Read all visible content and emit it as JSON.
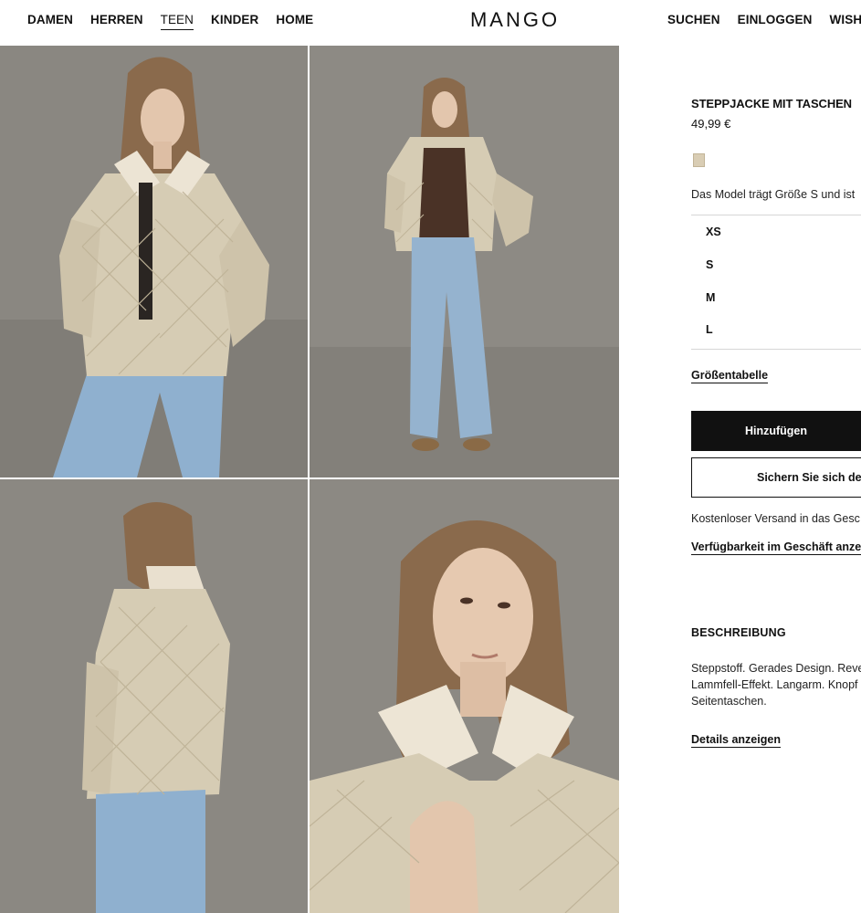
{
  "header": {
    "nav_left": [
      "DAMEN",
      "HERREN",
      "TEEN",
      "KINDER",
      "HOME"
    ],
    "active_nav": "TEEN",
    "logo": "MANGO",
    "nav_right": [
      "SUCHEN",
      "EINLOGGEN",
      "WISHL"
    ]
  },
  "gallery": {
    "photos": [
      {
        "name": "product-photo-front-closeup",
        "description_icon": "model-front-photo"
      },
      {
        "name": "product-photo-full-body",
        "description_icon": "model-fullbody-photo"
      },
      {
        "name": "product-photo-back-view",
        "description_icon": "model-back-photo"
      },
      {
        "name": "product-photo-portrait",
        "description_icon": "model-portrait-photo"
      }
    ]
  },
  "product": {
    "title": "STEPPJACKE MIT TASCHEN",
    "price": "49,99 €",
    "swatch_color": "#d9cdb4",
    "model_info": "Das Model trägt Größe S und ist",
    "sizes": [
      "XS",
      "S",
      "M",
      "L"
    ],
    "size_chart_label": "Größentabelle",
    "add_label": "Hinzufügen",
    "save_label": "Sichern Sie sich der",
    "shipping_text": "Kostenloser Versand in das Gesc",
    "availability_label": "Verfügbarkeit im Geschäft anzei",
    "description_heading": "BESCHREIBUNG",
    "description_lines": [
      "Steppstoff. Gerades Design. Reve",
      "Lammfell-Effekt. Langarm. Knopf",
      "Seitentaschen."
    ],
    "details_label": "Details anzeigen"
  },
  "colors": {
    "background": "#ffffff",
    "text": "#111111",
    "button_primary": "#111111",
    "photo_background": "#88857f",
    "jacket": "#d6ccb4"
  }
}
